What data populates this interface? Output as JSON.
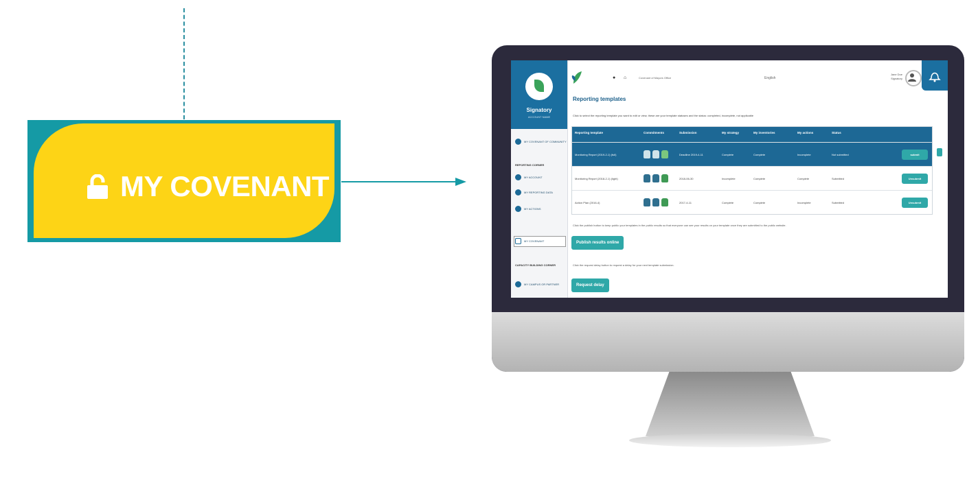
{
  "callout": {
    "label": "MY COVENANT",
    "icon": "unlock-icon",
    "color": "#fdd416",
    "border_color": "#159aa5"
  },
  "app": {
    "sidebar": {
      "title": "Signatory",
      "subtitle": "ACCOUNT NAME",
      "item_covenant": "MY COVENANT OF COMMUNITY",
      "section_reporting": "REPORTING CORNER",
      "reporting_items": [
        "MY ACCOUNT",
        "MY REPORTING DATA",
        "MY ACTIONS",
        "MY COVENANT"
      ],
      "section_capacity": "CAPACITY BUILDING CORNER",
      "capacity_items": [
        "MY CAMPUS OR PARTNER"
      ]
    },
    "topbar": {
      "breadcrumb": "Covenant of Mayors Office",
      "language": "English",
      "user_name": "Jane Doe",
      "user_role": "Signatory"
    },
    "page_title": "Reporting templates",
    "intro": "Click to select the reporting template you want to edit or view, these are your template statuses and the status: completed, incomplete, not applicable",
    "table": {
      "headers": [
        "Reporting template",
        "Commitments",
        "Submission",
        "My strategy",
        "My inventories",
        "My actions",
        "Status",
        ""
      ],
      "rows": [
        {
          "template": "Monitoring Report (2019-2-1) (full)",
          "submission": "Deadline 2019-4-11",
          "strategy": "Complete",
          "inventories": "Complete",
          "actions": "Incomplete",
          "status": "Not submitted",
          "action": "submit",
          "highlight": true
        },
        {
          "template": "Monitoring Report (2018-2-1) (light)",
          "submission": "2018-06-30",
          "strategy": "Incomplete",
          "inventories": "Complete",
          "actions": "Complete",
          "status": "Submitted",
          "action": "Unsubmit",
          "highlight": false
        },
        {
          "template": "Action Plan (2016-4)",
          "submission": "2017-4-11",
          "strategy": "Complete",
          "inventories": "Complete",
          "actions": "Incomplete",
          "status": "Submitted",
          "action": "Unsubmit",
          "highlight": false
        }
      ]
    },
    "note_publish": "Click the publish button to keep public your templates in the public results so that everyone can see your results on your template once they are submitted to the public website.",
    "publish_button": "Publish results online",
    "note_delay": "Click the request delay button to request a delay for your next template submission.",
    "delay_button": "Request delay"
  }
}
